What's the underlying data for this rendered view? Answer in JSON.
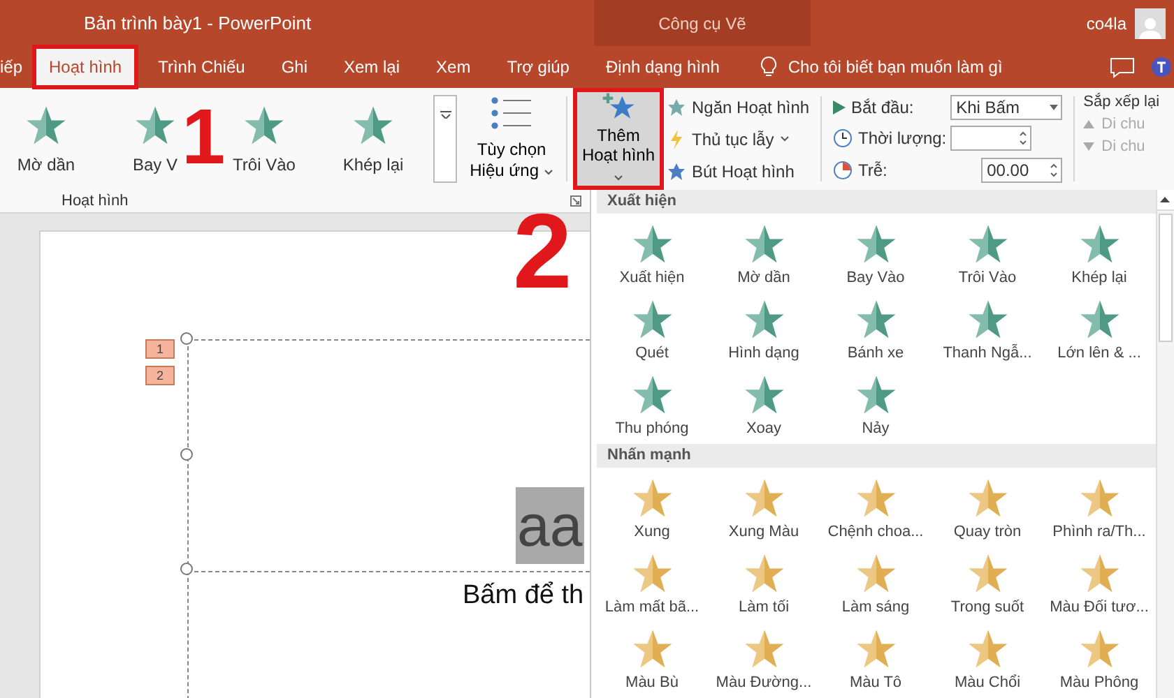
{
  "window": {
    "title": "Bản trình bày1  -  PowerPoint",
    "context_group": "Công cụ Vẽ",
    "user": "co4la"
  },
  "tabs": [
    {
      "label": "iếp",
      "selected": false,
      "outlined": false
    },
    {
      "label": "Hoạt hình",
      "selected": true,
      "outlined": true
    },
    {
      "label": "Trình Chiếu",
      "selected": false,
      "outlined": false
    },
    {
      "label": "Ghi",
      "selected": false,
      "outlined": false
    },
    {
      "label": "Xem lại",
      "selected": false,
      "outlined": false
    },
    {
      "label": "Xem",
      "selected": false,
      "outlined": false
    },
    {
      "label": "Trợ giúp",
      "selected": false,
      "outlined": false
    },
    {
      "label": "Định dạng hình",
      "selected": false,
      "outlined": false
    }
  ],
  "tell_me": "Cho tôi biết bạn muốn làm gì",
  "ribbon": {
    "gallery": [
      "Mờ dần",
      "Bay V",
      "Trôi Vào",
      "Khép lại"
    ],
    "effect_options": "Tùy chọn Hiệu ứng",
    "group_label": "Hoạt hình",
    "add_animation": {
      "label": "Thêm Hoạt hình",
      "outlined": true
    },
    "tools": [
      {
        "label": "Ngăn Hoạt hình",
        "dropdown": false
      },
      {
        "label": "Thủ tục lẫy",
        "dropdown": true
      },
      {
        "label": "Bút Hoạt hình",
        "dropdown": false
      }
    ],
    "timing": {
      "start_label": "Bắt đầu:",
      "start_value": "Khi Bấm",
      "duration_label": "Thời lượng:",
      "delay_label": "Trễ:",
      "delay_value": "00.00"
    },
    "reorder": {
      "title": "Sắp xếp lại",
      "items": [
        {
          "label": "Di chu",
          "disabled": true
        },
        {
          "label": "Di chu",
          "disabled": true
        }
      ]
    }
  },
  "slide": {
    "tags": [
      "1",
      "2"
    ],
    "title_text": "aa",
    "subtitle_text": "Bấm để th"
  },
  "gallery_panel": {
    "sections": [
      {
        "title": "Xuất hiện",
        "kind": "entrance",
        "items": [
          "Xuất hiện",
          "Mờ dần",
          "Bay Vào",
          "Trôi Vào",
          "Khép lại",
          "Quét",
          "Hình dạng",
          "Bánh xe",
          "Thanh Ngẫ...",
          "Lớn lên & ...",
          "Thu phóng",
          "Xoay",
          "Nảy"
        ]
      },
      {
        "title": "Nhấn mạnh",
        "kind": "emphasis",
        "items": [
          "Xung",
          "Xung Màu",
          "Chệnh choa...",
          "Quay tròn",
          "Phình ra/Th...",
          "Làm mất bã...",
          "Làm tối",
          "Làm sáng",
          "Trong suốt",
          "Màu Đối tươ...",
          "Màu Bù",
          "Màu Đường...",
          "Màu Tô",
          "Màu Chổi",
          "Màu Phông"
        ]
      }
    ]
  },
  "annotations": [
    {
      "number": "1"
    },
    {
      "number": "2"
    }
  ]
}
